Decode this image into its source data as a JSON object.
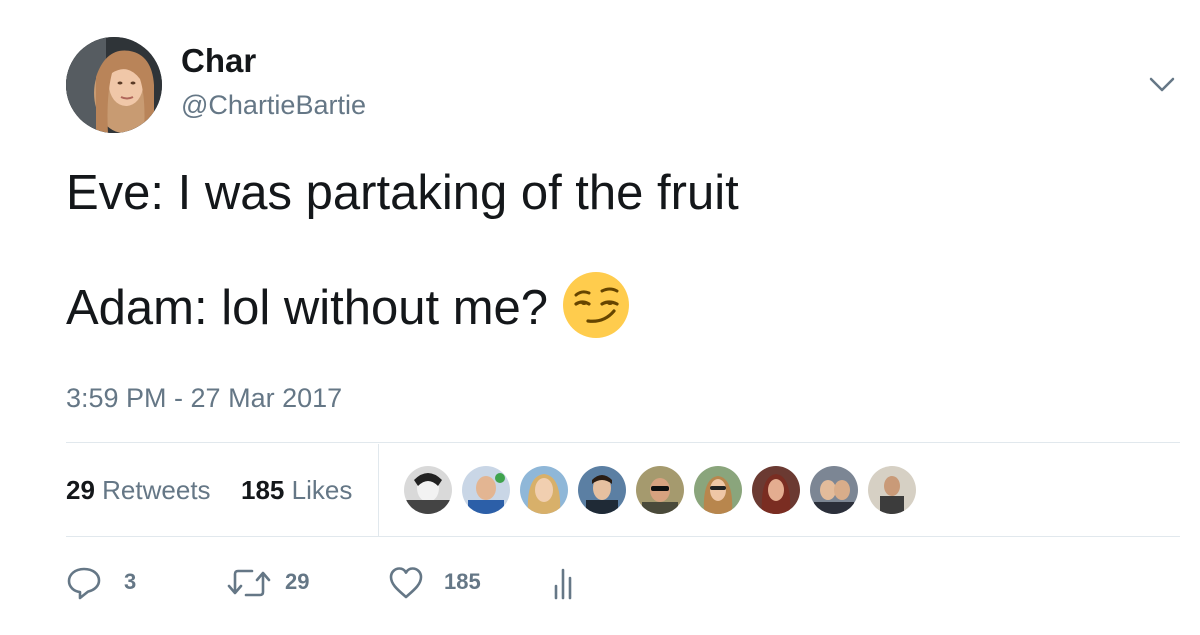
{
  "user": {
    "display_name": "Char",
    "handle": "@ChartieBartie",
    "avatar_icon": "profile-photo"
  },
  "tweet": {
    "line1": "Eve: I was partaking of the fruit",
    "line2": "Adam: lol without me?",
    "emoji": "smirking-face",
    "timestamp": "3:59 PM - 27 Mar 2017"
  },
  "stats": {
    "retweets_count": "29",
    "retweets_label": "Retweets",
    "likes_count": "185",
    "likes_label": "Likes",
    "liker_avatars": 9
  },
  "actions": {
    "reply_count": "3",
    "retweet_count": "29",
    "like_count": "185"
  },
  "colors": {
    "text": "#14171a",
    "secondary": "#657786",
    "divider": "#e1e8ed",
    "emoji": "#ffcc4d"
  }
}
